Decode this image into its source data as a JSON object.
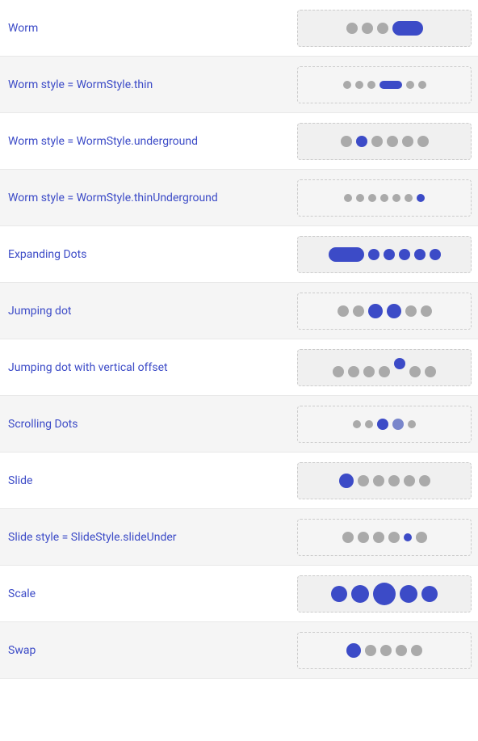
{
  "rows": [
    {
      "id": "worm",
      "label": "Worm",
      "preview_type": "worm"
    },
    {
      "id": "worm-thin",
      "label": "Worm style = WormStyle.thin",
      "preview_type": "worm-thin"
    },
    {
      "id": "worm-underground",
      "label": "Worm style = WormStyle.underground",
      "preview_type": "worm-underground"
    },
    {
      "id": "worm-thinUnderground",
      "label": "Worm style = WormStyle.thinUnderground",
      "preview_type": "worm-thinUnderground"
    },
    {
      "id": "expanding-dots",
      "label": "Expanding Dots",
      "preview_type": "expanding-dots"
    },
    {
      "id": "jumping-dot",
      "label": "Jumping dot",
      "preview_type": "jumping-dot"
    },
    {
      "id": "jumping-dot-offset",
      "label": "Jumping dot with vertical offset",
      "preview_type": "jumping-dot-offset"
    },
    {
      "id": "scrolling-dots",
      "label": "Scrolling Dots",
      "preview_type": "scrolling-dots"
    },
    {
      "id": "slide",
      "label": "Slide",
      "preview_type": "slide"
    },
    {
      "id": "slide-under",
      "label": "Slide style = SlideStyle.slideUnder",
      "preview_type": "slide-under"
    },
    {
      "id": "scale",
      "label": "Scale",
      "preview_type": "scale"
    },
    {
      "id": "swap",
      "label": "Swap",
      "preview_type": "swap"
    }
  ]
}
